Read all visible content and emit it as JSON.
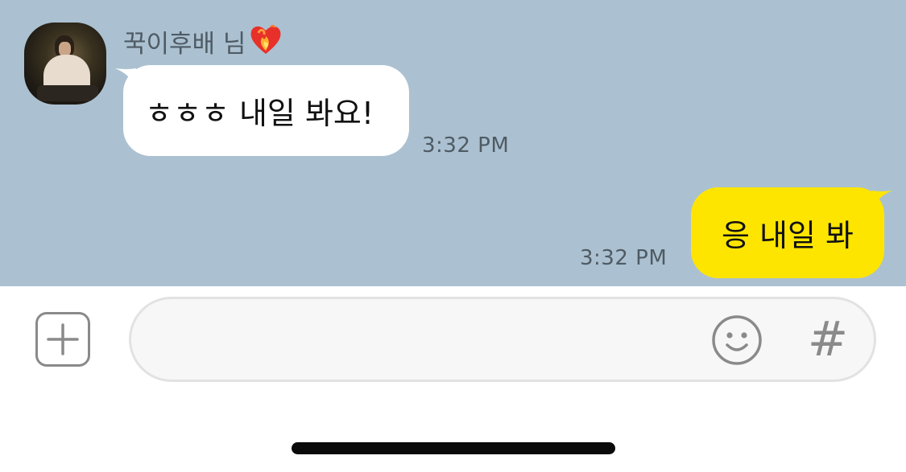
{
  "chat": {
    "background_color": "#abc1d1",
    "incoming": {
      "sender_name": "꾹이후배 님",
      "sender_badge": "heart-on-fire-emoji",
      "text": "ㅎㅎㅎ 내일 봐요!",
      "time": "3:32 PM",
      "bubble_color": "#ffffff"
    },
    "outgoing": {
      "text": "응 내일 봐",
      "time": "3:32 PM",
      "bubble_color": "#fee500"
    }
  },
  "input_bar": {
    "plus_icon": "plus-square-icon",
    "message_value": "",
    "emoji_icon": "smiley-icon",
    "hash_label": "#"
  }
}
